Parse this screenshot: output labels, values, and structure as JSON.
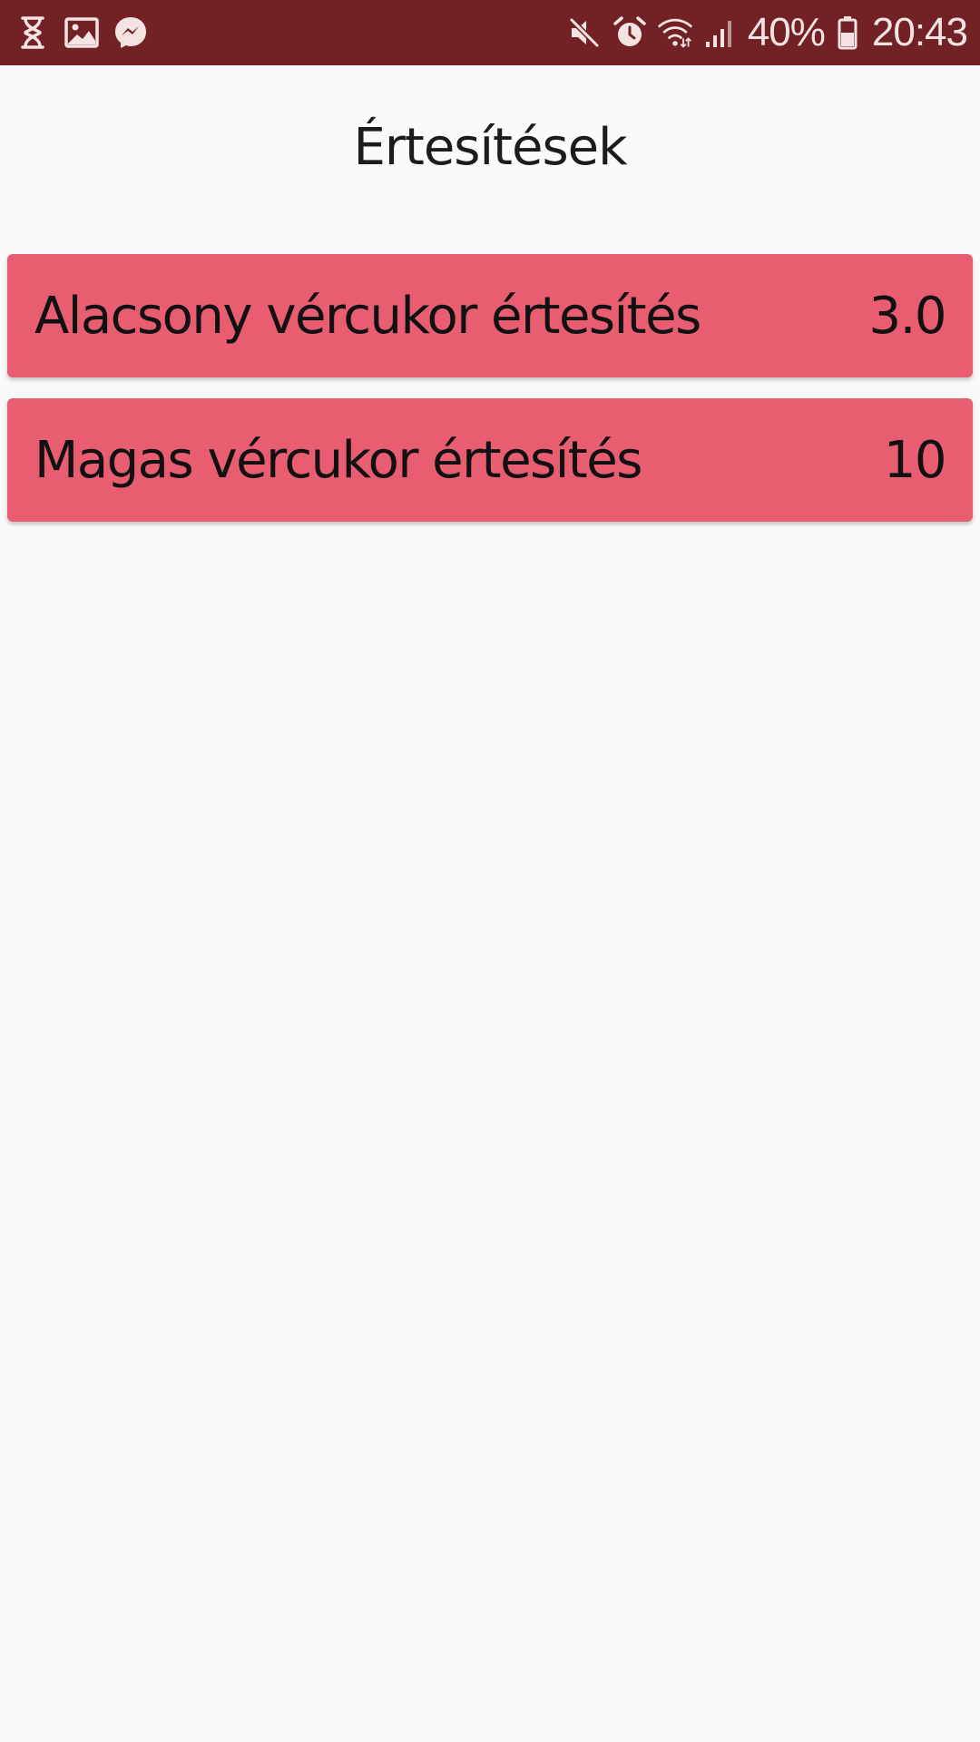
{
  "status_bar": {
    "left_icons": [
      "hourglass-icon",
      "image-icon",
      "messenger-icon"
    ],
    "right_icons": [
      "mute-icon",
      "alarm-icon",
      "wifi-icon",
      "signal-icon"
    ],
    "battery_percent": "40%",
    "time": "20:43",
    "background_color": "#722124"
  },
  "page": {
    "title": "Értesítések"
  },
  "settings": [
    {
      "label": "Alacsony vércukor értesítés",
      "value": "3.0"
    },
    {
      "label": "Magas vércukor értesítés",
      "value": "10"
    }
  ],
  "colors": {
    "row_background": "#e95d71",
    "page_background": "#fafafa"
  }
}
